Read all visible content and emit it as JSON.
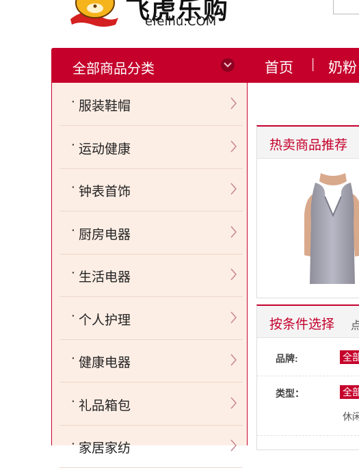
{
  "logo": {
    "cn_text": "飞虎乐购",
    "en_text": "efeihu.COM",
    "mascot_icon": "tiger-mascot-icon"
  },
  "nav": {
    "category_title": "全部商品分类",
    "home": "首页",
    "separator": "|",
    "milk": "奶粉"
  },
  "categories": [
    {
      "label": "服装鞋帽"
    },
    {
      "label": "运动健康"
    },
    {
      "label": "钟表首饰"
    },
    {
      "label": "厨房电器"
    },
    {
      "label": "生活电器"
    },
    {
      "label": "个人护理"
    },
    {
      "label": "健康电器"
    },
    {
      "label": "礼品箱包"
    },
    {
      "label": "家居家纺"
    }
  ],
  "hot": {
    "title": "热卖商品推荐"
  },
  "filter": {
    "title": "按条件选择",
    "extra": "点",
    "rows": [
      {
        "key": "品牌:",
        "tag": "全部"
      },
      {
        "key": "类型：",
        "tag": "全部",
        "extra": "休闲"
      }
    ]
  },
  "colors": {
    "brand_red": "#c5002b",
    "sidebar_bg": "#fdeee5"
  }
}
